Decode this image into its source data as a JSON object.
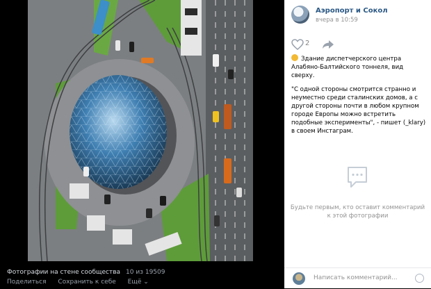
{
  "photo": {
    "alt_subject": "aerial-photo"
  },
  "footer": {
    "album_link": "Фотографии на стене сообщества",
    "counter": "10 из 19509",
    "share": "Поделиться",
    "save": "Сохранить к себе",
    "more": "Ещё ⌄"
  },
  "post": {
    "author": "Аэропорт и Сокол",
    "date": "вчера в 10:59",
    "likes": "2",
    "caption_line1": "Здание диспетчерского центра Алабяно-Балтийского тоннеля, вид сверху.",
    "caption_quote": "\"С одной стороны смотрится странно и неуместно среди сталинских домов, а с другой стороны почти в любом крупном городе Европы можно встретить подобные эксперименты\", - пишет (_klary) в своем Инстаграм."
  },
  "comments": {
    "empty_text": "Будьте первым, кто оставит комментарий к этой фотографии",
    "placeholder": "Написать комментарий..."
  },
  "colors": {
    "link": "#2a5885",
    "muted": "#939393",
    "glass": "#4a8fbf",
    "grass": "#5e9c3a",
    "road": "#6d7073"
  }
}
